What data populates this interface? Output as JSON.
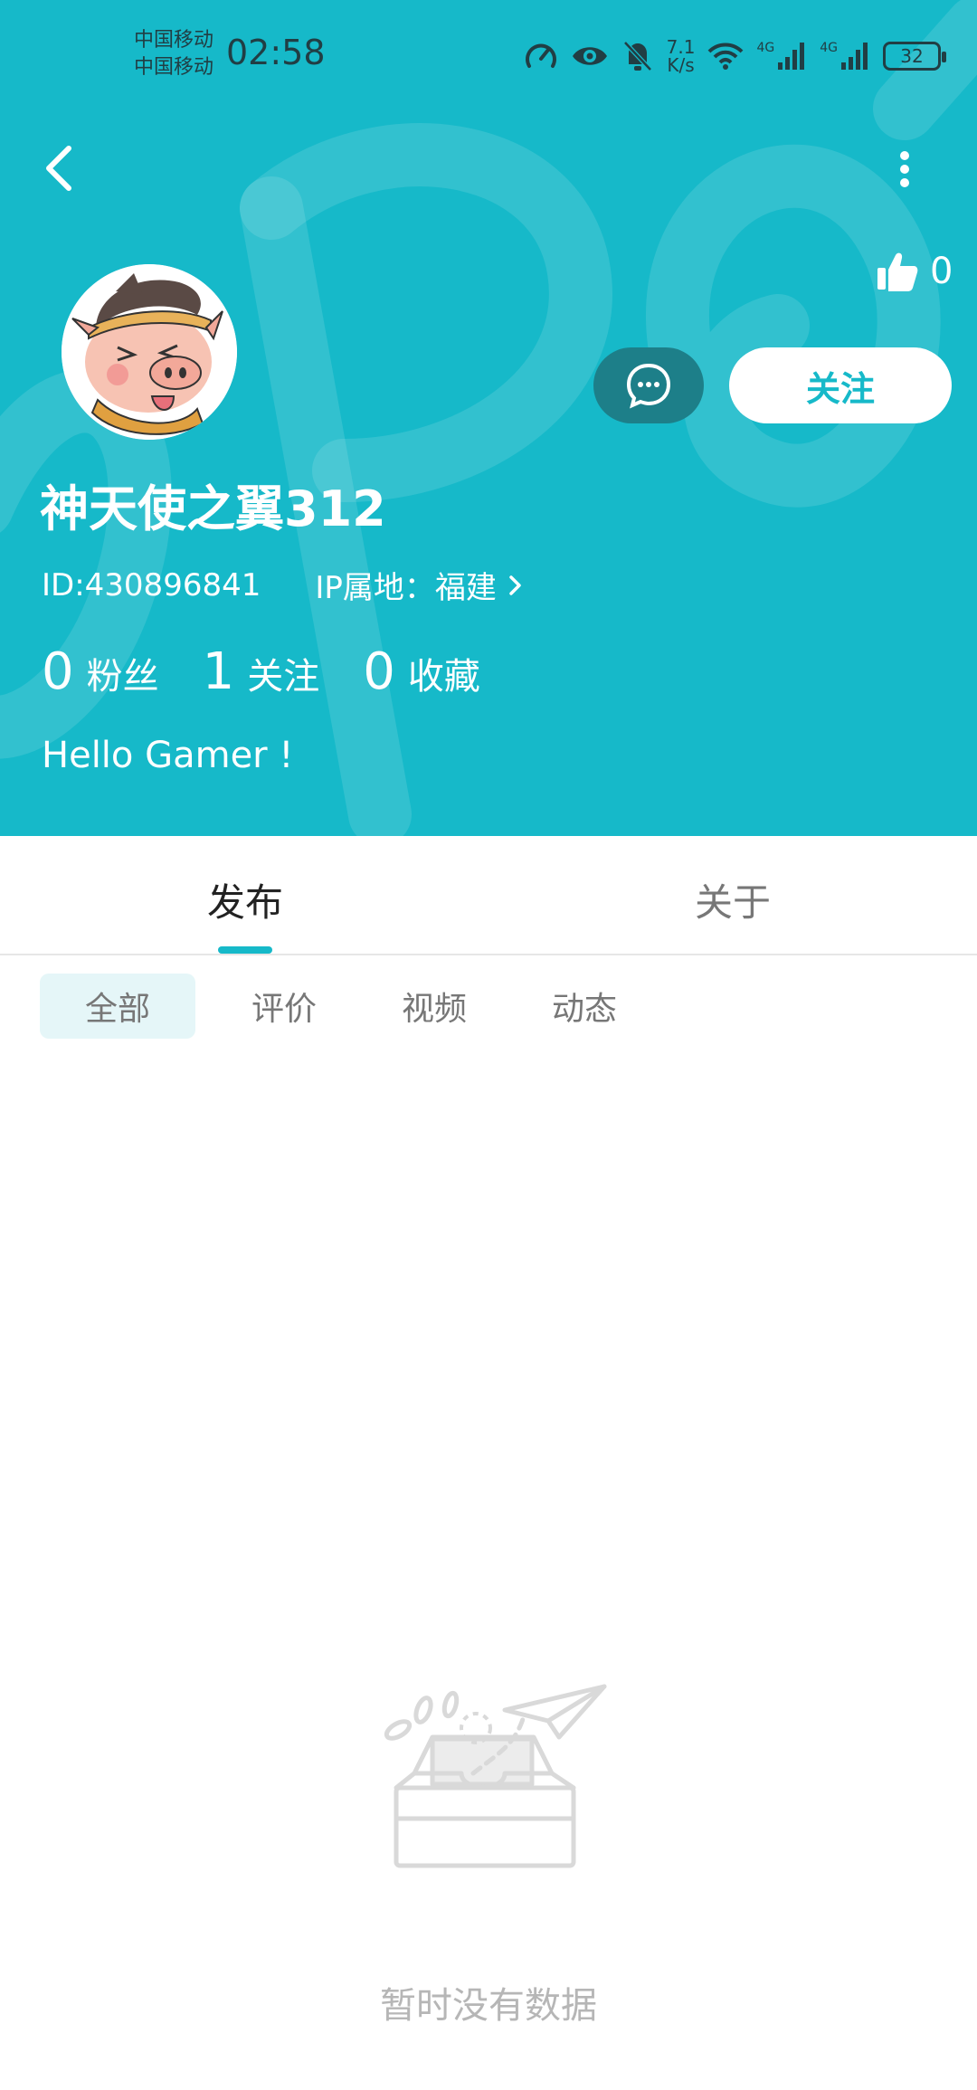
{
  "status_bar": {
    "carrier_1": "中国移动",
    "carrier_2": "中国移动",
    "time": "02:58",
    "net_speed_value": "7.1",
    "net_speed_unit": "K/s",
    "battery": "32",
    "signal_label_1": "4G",
    "signal_label_2": "4G"
  },
  "header": {
    "like_count": "0",
    "follow_label": "关注",
    "username": "神天使之翼312",
    "id_text": "ID:430896841",
    "ip_text": "IP属地：福建",
    "bio": "Hello Gamer !"
  },
  "stats": [
    {
      "value": "0",
      "label": "粉丝"
    },
    {
      "value": "1",
      "label": "关注"
    },
    {
      "value": "0",
      "label": "收藏"
    }
  ],
  "tabs": {
    "publish": "发布",
    "about": "关于"
  },
  "filters": [
    "全部",
    "评价",
    "视频",
    "动态"
  ],
  "empty": {
    "text": "暂时没有数据"
  },
  "colors": {
    "accent": "#16b9c9",
    "message_button": "#1d7f89"
  }
}
